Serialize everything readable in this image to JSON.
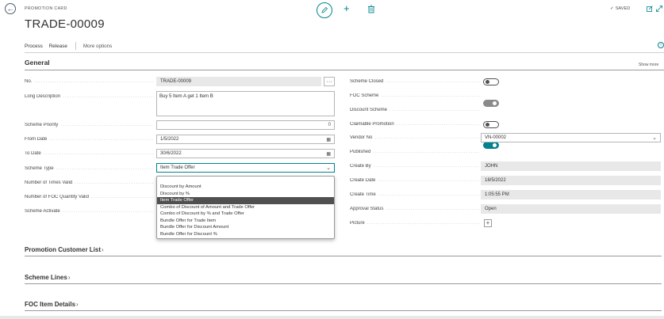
{
  "header": {
    "caption": "PROMOTION CARD",
    "title": "TRADE-00009",
    "saved_label": "SAVED"
  },
  "actions": {
    "process": "Process",
    "release": "Release",
    "more": "More options"
  },
  "general": {
    "title": "General",
    "show_more": "Show more",
    "left": {
      "no_label": "No.",
      "no_value": "TRADE-00009",
      "long_desc_label": "Long Description",
      "long_desc_value": "Buy 5 Item A get 1 Item B",
      "priority_label": "Scheme Priority",
      "priority_value": "0",
      "from_label": "From Date",
      "from_value": "1/5/2022",
      "to_label": "To Date",
      "to_value": "30/6/2022",
      "type_label": "Scheme Type",
      "type_value": "Item Trade Offer",
      "times_label": "Number of Times Valid",
      "foc_qty_label": "Number of FOC Quantity Valid",
      "activate_label": "Scheme Activate"
    },
    "right": {
      "closed_label": "Scheme Closed",
      "closed_value": false,
      "foc_label": "FOC Scheme",
      "foc_value": true,
      "discount_label": "Discount Scheme",
      "discount_value": false,
      "claimable_label": "Claimable Promotion",
      "claimable_value": true,
      "vendor_label": "Vendor No",
      "vendor_value": "VN-00002",
      "published_label": "Published",
      "published_value": false,
      "create_by_label": "Create By",
      "create_by_value": "JOHN",
      "create_date_label": "Create Date",
      "create_date_value": "18/5/2022",
      "create_time_label": "Create Time",
      "create_time_value": "1:05:55 PM",
      "approval_label": "Approval Status",
      "approval_value": "Open",
      "picture_label": "Picture"
    }
  },
  "scheme_type_options": [
    "Discount by Amount",
    "Discount by %",
    "Item Trade Offer",
    "Combo of Discount of Amount and Trade Offer",
    "Combo of Discount by % and Trade Offer",
    "Bundle Offer for Trade Item",
    "Bundle Offer for Discount Amount",
    "Bundle Offer for Discount %"
  ],
  "subsections": {
    "customer_list": "Promotion Customer List",
    "scheme_lines": "Scheme Lines",
    "foc_items": "FOC Item Details"
  },
  "colors": {
    "accent": "#00838f",
    "readonly_bg": "#e8e8e8",
    "selected_option_bg": "#505050"
  }
}
